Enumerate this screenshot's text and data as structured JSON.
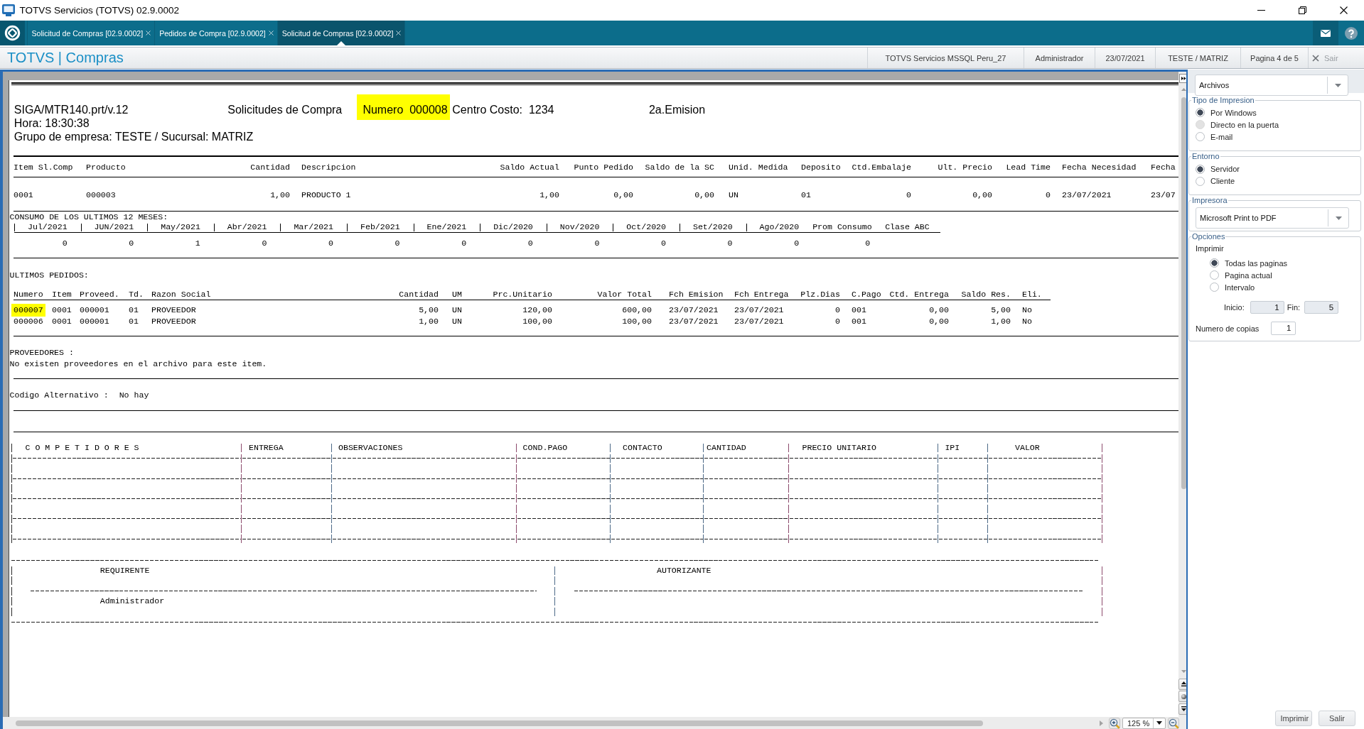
{
  "window": {
    "title": "TOTVS Servicios (TOTVS) 02.9.0002"
  },
  "tabs": [
    {
      "label": "Solicitud de Compras [02.9.0002]",
      "selected": false
    },
    {
      "label": "Pedidos de Compra [02.9.0002]",
      "selected": false
    },
    {
      "label": "Solicitud de Compras [02.9.0002]",
      "selected": true
    }
  ],
  "module_bar": {
    "title": "TOTVS | Compras",
    "server": "TOTVS Servicios MSSQL Peru_27",
    "user": "Administrador",
    "date": "23/07/2021",
    "company": "TESTE / MATRIZ",
    "page": "Pagina 4 de 5",
    "exit_label": "Sair"
  },
  "report": {
    "header": {
      "program": "SIGA/MTR140.prt/v.12",
      "title": "Solicitudes de Compra",
      "number": {
        "text": "Numero  000008",
        "highlighted": true
      },
      "cost_center": "Centro Costo:  1234",
      "emission": "2a.Emision",
      "time": "Hora: 18:30:38",
      "company": "Grupo de empresa: TESTE / Sucursal: MATRIZ"
    },
    "items": {
      "columns": [
        "Item Sl.Comp",
        "Producto",
        "Cantidad",
        "Descripcion",
        "Saldo Actual",
        "Punto Pedido",
        "Saldo de la SC",
        "Unid. Medida",
        "Deposito",
        "Ctd.Embalaje",
        "Ult. Precio",
        "Lead Time",
        "Fecha Necesidad",
        "Fecha"
      ],
      "rows": [
        [
          "0001",
          "000003",
          "1,00",
          "PRODUCTO 1",
          "1,00",
          "0,00",
          "0,00",
          "UN",
          "01",
          "0",
          "0,00",
          "0",
          "23/07/2021",
          "23/07"
        ]
      ]
    },
    "consumption": {
      "title": "CONSUMO DE LOS ULTIMOS 12 MESES:",
      "months": [
        "Jul/2021",
        "JUN/2021",
        "May/2021",
        "Abr/2021",
        "Mar/2021",
        "Feb/2021",
        "Ene/2021",
        "Dic/2020",
        "Nov/2020",
        "Oct/2020",
        "Set/2020",
        "Ago/2020"
      ],
      "summary_columns": [
        "Prom Consumo",
        "Clase ABC"
      ],
      "month_values": [
        "0",
        "0",
        "1",
        "0",
        "0",
        "0",
        "0",
        "0",
        "0",
        "0",
        "0",
        "0"
      ],
      "summary_values": [
        "0"
      ]
    },
    "orders": {
      "title": "ULTIMOS PEDIDOS:",
      "columns": [
        "Numero",
        "Item",
        "Proveed.",
        "Td.",
        "Razon Social",
        "Cantidad",
        "UM",
        "Prc.Unitario",
        "Valor Total",
        "Fch Emision",
        "Fch Entrega",
        "Plz.Dias",
        "C.Pago",
        "Ctd. Entrega",
        "Saldo Res.",
        "Eli."
      ],
      "rows": [
        {
          "cells": [
            "000007",
            "0001",
            "000001",
            "01",
            "PROVEEDOR",
            "5,00",
            "UN",
            "120,00",
            "600,00",
            "23/07/2021",
            "23/07/2021",
            "0",
            "001",
            "0,00",
            "5,00",
            "No"
          ],
          "highlighted": true
        },
        {
          "cells": [
            "000006",
            "0001",
            "000001",
            "01",
            "PROVEEDOR",
            "1,00",
            "UN",
            "100,00",
            "100,00",
            "23/07/2021",
            "23/07/2021",
            "0",
            "001",
            "0,00",
            "1,00",
            "No"
          ],
          "highlighted": false
        }
      ]
    },
    "suppliers": {
      "title": "PROVEEDORES :",
      "message": "No existen proveedores en el archivo para este item."
    },
    "alternative_code": {
      "label": "Codigo Alternativo :",
      "value": "No hay"
    },
    "competitors": {
      "columns": [
        "C O M P E T I D O R E S",
        "ENTREGA",
        "OBSERVACIONES",
        "COND.PAGO",
        "CONTACTO",
        "CANTIDAD",
        "PRECIO UNITARIO",
        "IPI",
        "VALOR"
      ]
    },
    "signatures": [
      {
        "role": "REQUIRENTE",
        "name": "Administrador"
      },
      {
        "role": "AUTORIZANTE"
      }
    ]
  },
  "zoom": {
    "value": "125 %"
  },
  "print_panel": {
    "destination": {
      "value": "Archivos"
    },
    "print_type": {
      "title": "Tipo de Impresion",
      "options": [
        {
          "label": "Por Windows",
          "selected": true,
          "disabled": false
        },
        {
          "label": "Directo en la puerta",
          "selected": false,
          "disabled": true
        },
        {
          "label": "E-mail",
          "selected": false,
          "disabled": false
        }
      ]
    },
    "environment": {
      "title": "Entorno",
      "options": [
        {
          "label": "Servidor",
          "selected": true
        },
        {
          "label": "Cliente",
          "selected": false
        }
      ]
    },
    "printer": {
      "title": "Impresora",
      "value": "Microsoft Print to PDF"
    },
    "options": {
      "title": "Opciones",
      "label": "Imprimir",
      "choices": [
        {
          "label": "Todas las paginas",
          "selected": true
        },
        {
          "label": "Pagina actual",
          "selected": false
        },
        {
          "label": "Intervalo",
          "selected": false
        }
      ],
      "range": {
        "from_label": "Inicio:",
        "from": "1",
        "to_label": "Fin:",
        "to": "5",
        "disabled": true
      },
      "copies": {
        "label": "Numero de copias",
        "value": "1",
        "disabled": false
      }
    },
    "buttons": [
      "Imprimir",
      "Salir"
    ]
  }
}
